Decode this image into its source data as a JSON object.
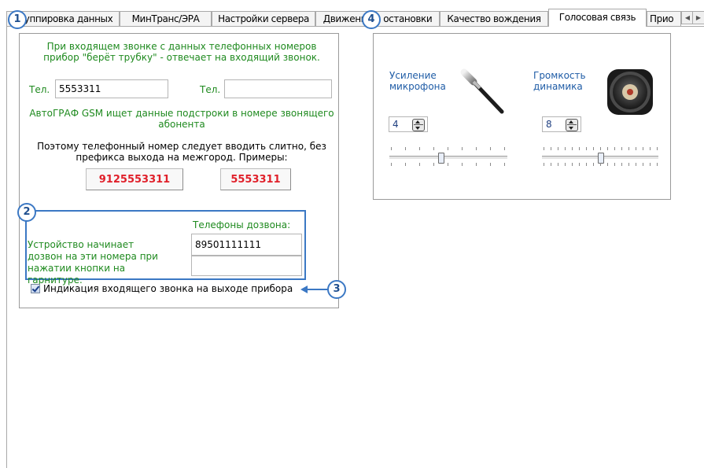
{
  "tabs": [
    {
      "label": "Группировка данных",
      "active": false
    },
    {
      "label": "МинТранс/ЭРА",
      "active": false
    },
    {
      "label": "Настройки сервера",
      "active": false
    },
    {
      "label": "Движение и остановки",
      "active": false
    },
    {
      "label": "Качество вождения",
      "active": false
    },
    {
      "label": "Голосовая связь",
      "active": true
    },
    {
      "label": "Прио",
      "active": false
    }
  ],
  "callouts": {
    "one": "1",
    "two": "2",
    "three": "3",
    "four": "4"
  },
  "incoming": {
    "description": "При входящем звонке с данных телефонных номеров прибор \"берёт трубку\" - отвечает на входящий звонок.",
    "phone1_label": "Тел.",
    "phone1_value": "5553311",
    "phone2_label": "Тел.",
    "phone2_value": "",
    "substring_note": "АвтоГРАФ GSM ищет данные подстроки в номере звонящего абонента",
    "format_note": "Поэтому телефонный номер следует вводить слитно, без префикса выхода на межгород. Примеры:",
    "example1": "9125553311",
    "example2": "5553311"
  },
  "dialing": {
    "header": "Телефоны дозвона:",
    "description": "Устройство начинает дозвон на эти номера при нажатии кнопки на гарнитуре.",
    "number1": "89501111111",
    "number2": ""
  },
  "indication": {
    "label": "Индикация входящего звонка на выходе прибора",
    "checked": true
  },
  "audio": {
    "mic_label": "Усиление микрофона",
    "mic_value": "4",
    "speaker_label": "Громкость динамика",
    "speaker_value": "8"
  },
  "colors": {
    "green_text": "#1f8a1f",
    "blue_text": "#1f5ca6",
    "red_example": "#e0202a",
    "callout_blue": "#3b78c4"
  }
}
